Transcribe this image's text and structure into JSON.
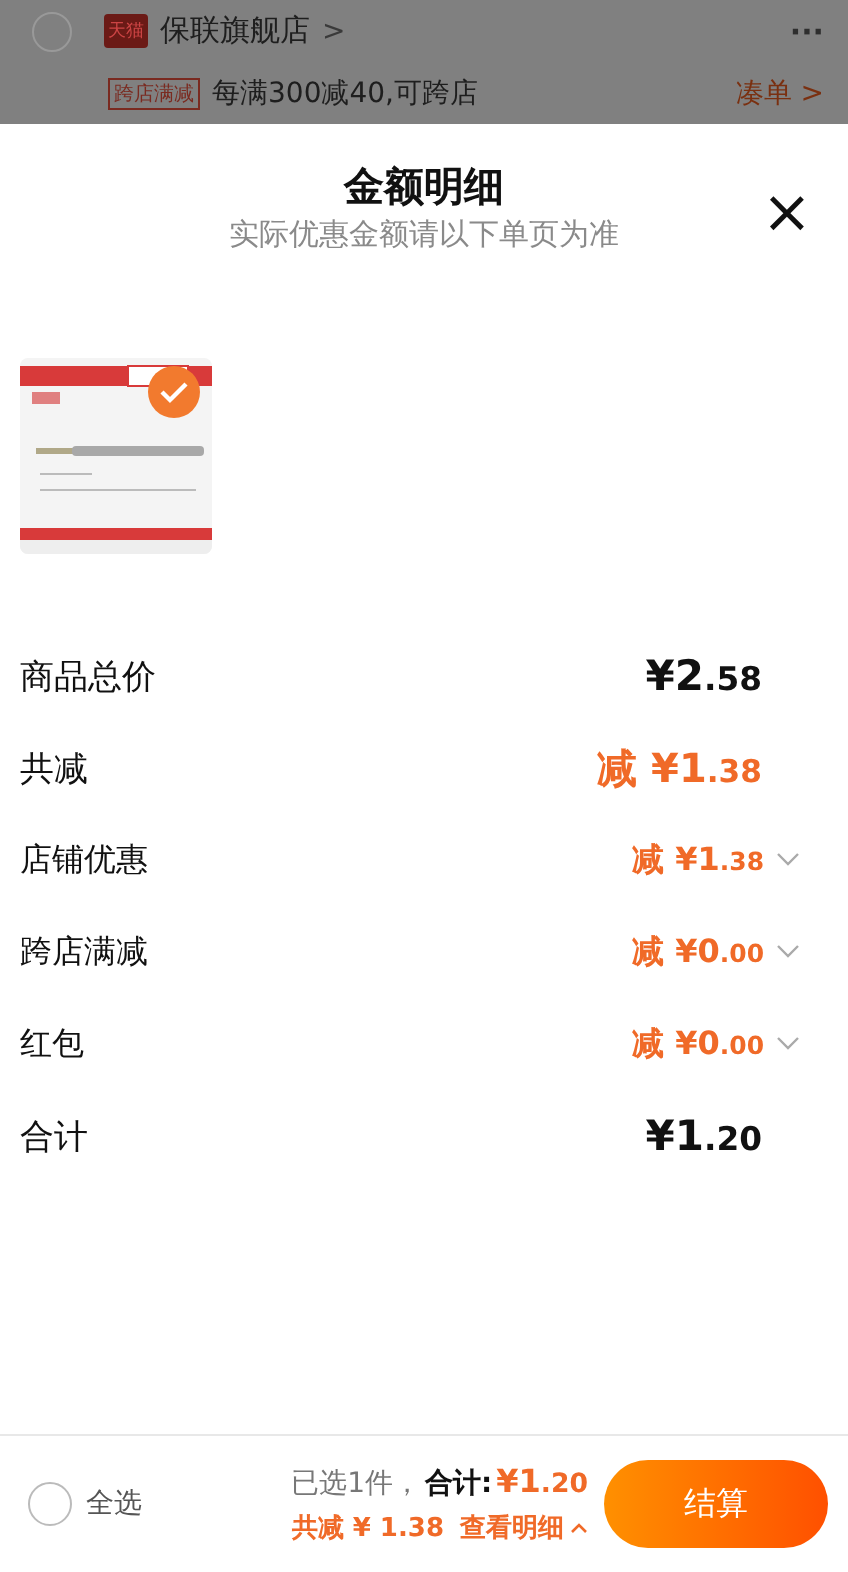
{
  "background_cart": {
    "store": {
      "checked": false,
      "badge": "天猫",
      "name": "保联旗舰店",
      "chevron": ">",
      "more": "···"
    },
    "promo": {
      "badge": "跨店满减",
      "text": "每满300减40,可跨店",
      "link": "凑单 >"
    }
  },
  "sheet": {
    "title": "金额明细",
    "subtitle": "实际优惠金额请以下单页为准",
    "close": "×",
    "products": [
      {
        "kind": "picture",
        "selected": true
      }
    ],
    "rows": [
      {
        "kind": "total",
        "label": "商品总价",
        "value": "¥2.58"
      },
      {
        "kind": "discount",
        "label": "共减",
        "value": "减 ¥1.38"
      },
      {
        "kind": "detail",
        "label": "店铺优惠",
        "value": "减 ¥1.38",
        "expanded": false
      },
      {
        "kind": "detail",
        "label": "跨店满减",
        "value": "减 ¥0.00",
        "expanded": false
      },
      {
        "kind": "detail",
        "label": "红包",
        "value": "减 ¥0.00",
        "expanded": false
      },
      {
        "kind": "total",
        "label": "合计",
        "value": "¥1.20"
      }
    ]
  },
  "bottom_bar": {
    "select_all": {
      "label": "全选",
      "checked": false
    },
    "selected_count": "已选1件，",
    "total_label": "合计:",
    "total": "¥1.20",
    "discount": "共减 ¥ 1.38",
    "details_link": "查看明细",
    "details_expanded": true,
    "checkout": "结算"
  }
}
